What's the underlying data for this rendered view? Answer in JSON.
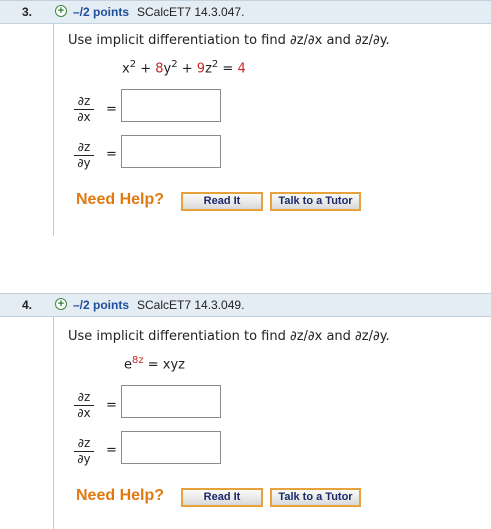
{
  "questions": [
    {
      "number": "3.",
      "points": "–/2 points",
      "reference": "SCalcET7 14.3.047.",
      "prompt": "Use implicit differentiation to find ∂z/∂x and ∂z/∂y.",
      "equation": {
        "lhs_parts": [
          "x",
          "2",
          " + ",
          "8",
          "y",
          "2",
          " + ",
          "9",
          "z",
          "2",
          " = ",
          "4"
        ]
      },
      "answers": [
        {
          "numerator": "∂z",
          "denominator": "∂x",
          "equals": "=",
          "value": ""
        },
        {
          "numerator": "∂z",
          "denominator": "∂y",
          "equals": "=",
          "value": ""
        }
      ],
      "need_help": "Need Help?",
      "read_it": "Read It",
      "talk_tutor": "Talk to a Tutor"
    },
    {
      "number": "4.",
      "points": "–/2 points",
      "reference": "SCalcET7 14.3.049.",
      "prompt": "Use implicit differentiation to find ∂z/∂x and ∂z/∂y.",
      "equation": {
        "base": "e",
        "exponent": "8z",
        "rhs": " = xyz"
      },
      "answers": [
        {
          "numerator": "∂z",
          "denominator": "∂x",
          "equals": "=",
          "value": ""
        },
        {
          "numerator": "∂z",
          "denominator": "∂y",
          "equals": "=",
          "value": ""
        }
      ],
      "need_help": "Need Help?",
      "read_it": "Read It",
      "talk_tutor": "Talk to a Tutor"
    }
  ],
  "colors": {
    "accent_red": "#c62828",
    "help_orange": "#e07a10",
    "points_blue": "#1f4e9c",
    "header_bg": "#e4ecf4"
  },
  "icons": {
    "expand": "plus-circle-icon"
  }
}
